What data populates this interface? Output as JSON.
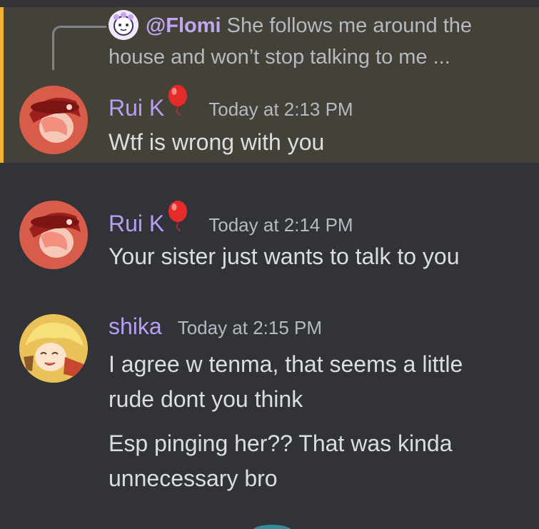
{
  "reply": {
    "author": "@Flomi",
    "text_line1": "She follows me around the",
    "text_line2": "house and won’t stop talking to me ..."
  },
  "messages": [
    {
      "username": "Rui K",
      "timestamp": "Today at 2:13 PM",
      "lines": [
        "Wtf is wrong with you"
      ],
      "highlighted": true
    },
    {
      "username": "Rui K",
      "timestamp": "Today at 2:14 PM",
      "lines": [
        "Your sister just wants to talk to you"
      ]
    },
    {
      "username": "shika",
      "timestamp": "Today at 2:15 PM",
      "lines": [
        "I agree w tenma, that seems a little",
        "rude  dont you think"
      ],
      "followup_lines": [
        "Esp pinging her?? That was kinda",
        "unnecessary bro"
      ]
    }
  ],
  "colors": {
    "background": "#313338",
    "highlight_bg": "#444238",
    "highlight_bar": "#f0b232",
    "username": "#b89ef5",
    "text": "#dbdee1",
    "muted": "#b5bac1"
  },
  "icons": {
    "balloon": "red-balloon-emoji"
  }
}
